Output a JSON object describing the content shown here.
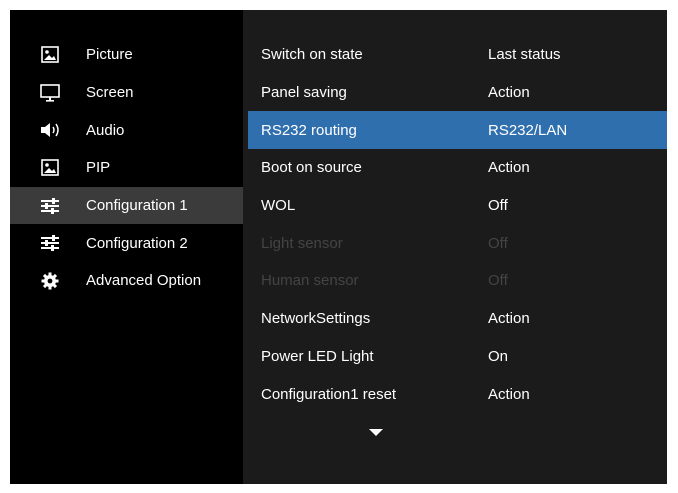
{
  "sidebar": {
    "items": [
      {
        "label": "Picture",
        "icon": "picture-icon"
      },
      {
        "label": "Screen",
        "icon": "monitor-icon"
      },
      {
        "label": "Audio",
        "icon": "speaker-icon"
      },
      {
        "label": "PIP",
        "icon": "pip-icon"
      },
      {
        "label": "Configuration 1",
        "icon": "sliders-icon",
        "active": true
      },
      {
        "label": "Configuration 2",
        "icon": "sliders-icon"
      },
      {
        "label": "Advanced Option",
        "icon": "gear-icon"
      }
    ]
  },
  "menu": {
    "rows": [
      {
        "name": "Switch on state",
        "value": "Last status"
      },
      {
        "name": "Panel saving",
        "value": "Action"
      },
      {
        "name": "RS232 routing",
        "value": "RS232/LAN",
        "selected": true
      },
      {
        "name": "Boot on source",
        "value": "Action"
      },
      {
        "name": "WOL",
        "value": "Off"
      },
      {
        "name": "Light sensor",
        "value": "Off",
        "disabled": true
      },
      {
        "name": "Human sensor",
        "value": "Off",
        "disabled": true
      },
      {
        "name": "NetworkSettings",
        "value": "Action"
      },
      {
        "name": "Power LED Light",
        "value": "On"
      },
      {
        "name": "Configuration1 reset",
        "value": "Action"
      }
    ],
    "more_indicator": "scroll-down-arrow-icon"
  },
  "colors": {
    "background": "#000000",
    "panel": "#1b1b1b",
    "sidebar_active": "#3b3b3b",
    "selection": "#2f6fad",
    "text": "#ffffff",
    "disabled_text": "#444444"
  }
}
